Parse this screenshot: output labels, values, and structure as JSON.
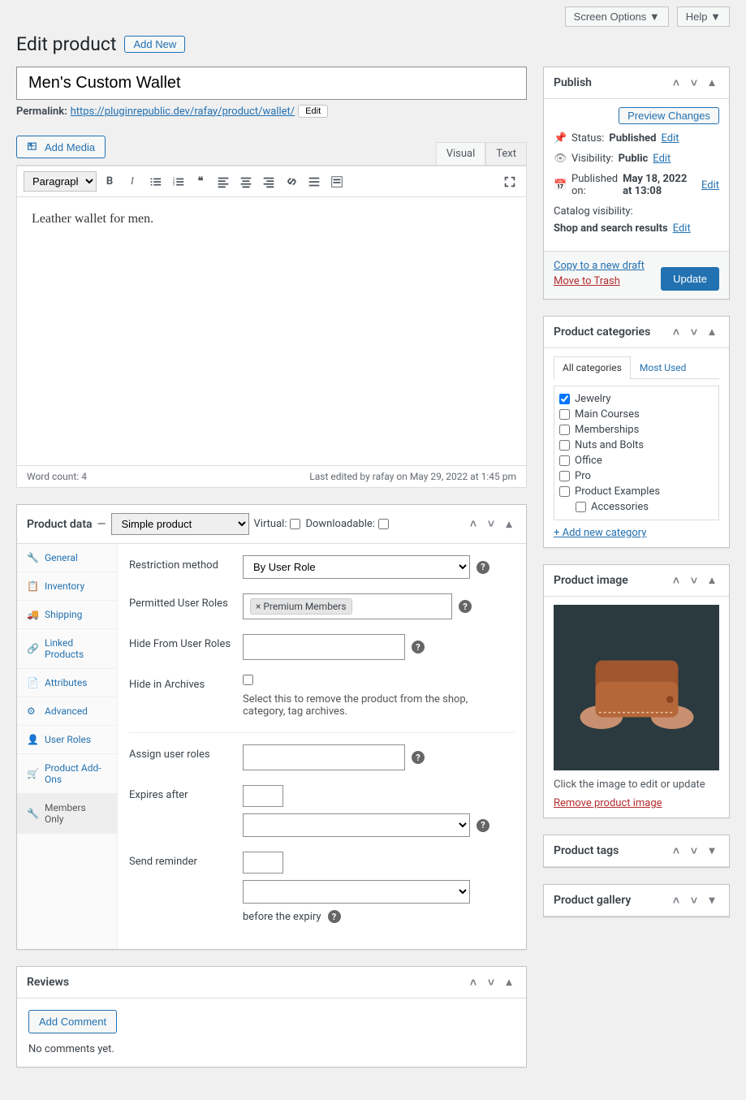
{
  "topbar": {
    "screen_options": "Screen Options",
    "help": "Help"
  },
  "header": {
    "title": "Edit product",
    "add_new": "Add New"
  },
  "title_field": {
    "value": "Men's Custom Wallet"
  },
  "permalink": {
    "label": "Permalink:",
    "url": "https://pluginrepublic.dev/rafay/product/wallet/",
    "edit": "Edit"
  },
  "editor": {
    "add_media": "Add Media",
    "tab_visual": "Visual",
    "tab_text": "Text",
    "format_select": "Paragraph",
    "content": "Leather wallet for men.",
    "word_count_lbl": "Word count: ",
    "word_count": "4",
    "last_edit": "Last edited by rafay on May 29, 2022 at 1:45 pm"
  },
  "product_data": {
    "heading": "Product data",
    "type": "Simple product",
    "virtual_lbl": "Virtual:",
    "downloadable_lbl": "Downloadable:",
    "tabs": {
      "general": "General",
      "inventory": "Inventory",
      "shipping": "Shipping",
      "linked": "Linked Products",
      "attributes": "Attributes",
      "advanced": "Advanced",
      "user_roles": "User Roles",
      "addons": "Product Add-Ons",
      "members": "Members Only"
    },
    "fields": {
      "restriction_method": "Restriction method",
      "restriction_method_val": "By User Role",
      "permitted_roles": "Permitted User Roles",
      "permitted_roles_tag": "× Premium Members",
      "hide_roles": "Hide From User Roles",
      "hide_archives": "Hide in Archives",
      "hide_archives_desc": "Select this to remove the product from the shop, category, tag archives.",
      "assign_roles": "Assign user roles",
      "expires_after": "Expires after",
      "send_reminder": "Send reminder",
      "before_expiry": "before the expiry"
    }
  },
  "reviews": {
    "heading": "Reviews",
    "add_comment": "Add Comment",
    "none": "No comments yet."
  },
  "publish": {
    "heading": "Publish",
    "preview": "Preview Changes",
    "status_lbl": "Status:",
    "status_val": "Published",
    "visibility_lbl": "Visibility:",
    "visibility_val": "Public",
    "pub_on_lbl": "Published on:",
    "pub_on_val": "May 18, 2022 at 13:08",
    "catalog_lbl": "Catalog visibility:",
    "catalog_val": "Shop and search results",
    "edit": "Edit",
    "copy_draft": "Copy to a new draft",
    "trash": "Move to Trash",
    "update": "Update"
  },
  "categories": {
    "heading": "Product categories",
    "tab_all": "All categories",
    "tab_most": "Most Used",
    "items": [
      {
        "label": "Jewelry",
        "checked": true
      },
      {
        "label": "Main Courses",
        "checked": false
      },
      {
        "label": "Memberships",
        "checked": false
      },
      {
        "label": "Nuts and Bolts",
        "checked": false
      },
      {
        "label": "Office",
        "checked": false
      },
      {
        "label": "Pro",
        "checked": false
      },
      {
        "label": "Product Examples",
        "checked": false
      }
    ],
    "sub": "Accessories",
    "add_new": "+ Add new category"
  },
  "product_image": {
    "heading": "Product image",
    "caption": "Click the image to edit or update",
    "remove": "Remove product image"
  },
  "tags": {
    "heading": "Product tags"
  },
  "gallery": {
    "heading": "Product gallery"
  }
}
